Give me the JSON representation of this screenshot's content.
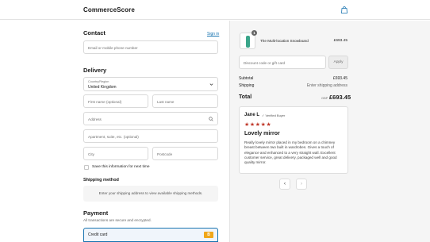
{
  "header": {
    "brand": "CommerceScore",
    "cart_icon": "shopping-bag-icon"
  },
  "contact": {
    "heading": "Contact",
    "sign_in": "Sign in",
    "email_placeholder": "Email or mobile phone number"
  },
  "delivery": {
    "heading": "Delivery",
    "country_label": "Country/Region",
    "country_value": "United Kingdom",
    "first_name_placeholder": "First name (optional)",
    "last_name_placeholder": "Last name",
    "address_placeholder": "Address",
    "apartment_placeholder": "Apartment, suite, etc. (optional)",
    "city_placeholder": "City",
    "postcode_placeholder": "Postcode",
    "save_info_label": "Save this information for next time"
  },
  "shipping_method": {
    "heading": "Shipping method",
    "message": "Enter your shipping address to view available shipping methods."
  },
  "payment": {
    "heading": "Payment",
    "note": "All transactions are secure and encrypted.",
    "method": "Credit card",
    "method_badge": "B"
  },
  "summary": {
    "product": {
      "quantity": "1",
      "name": "The Multi-location Snowboard",
      "price": "£693.45"
    },
    "discount_placeholder": "Discount code or gift card",
    "apply_label": "Apply",
    "subtotal_label": "Subtotal",
    "subtotal_value": "£693.45",
    "shipping_label": "Shipping",
    "shipping_value": "Enter shipping address",
    "total_label": "Total",
    "currency": "GBP",
    "total_value": "£693.45"
  },
  "review": {
    "name": "Jane L",
    "verified": "✓ Verified Buyer",
    "stars": "★★★★★",
    "rating": 5,
    "title": "Lovely mirror",
    "body": "Really lovely mirror placed in my bedroom on a chimney breast between two built in wardrobes. Gives a touch of elegance and enhanced to a very straight wall. Excellent customer service, great delivery, packaged well and good quality mirror.",
    "prev": "‹",
    "next": "›"
  },
  "colors": {
    "accent": "#1773b0",
    "stars": "#c0392b",
    "badge": "#f0a71a",
    "panel": "#f5f5f5"
  }
}
